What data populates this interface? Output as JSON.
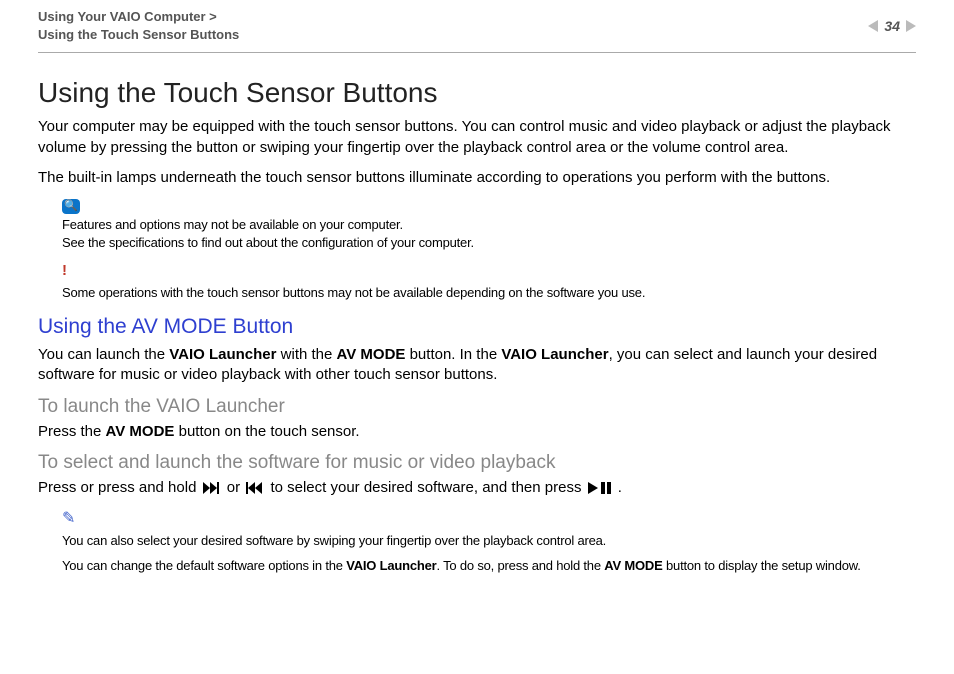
{
  "header": {
    "breadcrumb_line1": "Using Your VAIO Computer >",
    "breadcrumb_line2": "Using the Touch Sensor Buttons",
    "page_number": "34"
  },
  "main": {
    "title": "Using the Touch Sensor Buttons",
    "intro1": "Your computer may be equipped with the touch sensor buttons. You can control music and video playback or adjust the playback volume by pressing the button or swiping your fingertip over the playback control area or the volume control area.",
    "intro2": "The built-in lamps underneath the touch sensor buttons illuminate according to operations you perform with the buttons.",
    "info_note1": "Features and options may not be available on your computer.",
    "info_note2": "See the specifications to find out about the configuration of your computer.",
    "warn_note": "Some operations with the touch sensor buttons may not be available depending on the software you use.",
    "h2_av": "Using the AV MODE Button",
    "av_p_a": "You can launch the ",
    "av_p_b": "VAIO Launcher",
    "av_p_c": " with the ",
    "av_p_d": "AV MODE",
    "av_p_e": " button. In the ",
    "av_p_f": "VAIO Launcher",
    "av_p_g": ", you can select and launch your desired software for music or video playback with other touch sensor buttons.",
    "h3_launch": "To launch the VAIO Launcher",
    "launch_a": "Press the ",
    "launch_b": "AV MODE",
    "launch_c": " button on the touch sensor.",
    "h3_select": "To select and launch the software for music or video playback",
    "select_a": "Press or press and hold ",
    "select_b": " or ",
    "select_c": " to select your desired software, and then press ",
    "select_d": ".",
    "tip1": "You can also select your desired software by swiping your fingertip over the playback control area.",
    "tip2_a": "You can change the default software options in the ",
    "tip2_b": "VAIO Launcher",
    "tip2_c": ". To do so, press and hold the ",
    "tip2_d": "AV MODE",
    "tip2_e": " button to display the setup window."
  }
}
